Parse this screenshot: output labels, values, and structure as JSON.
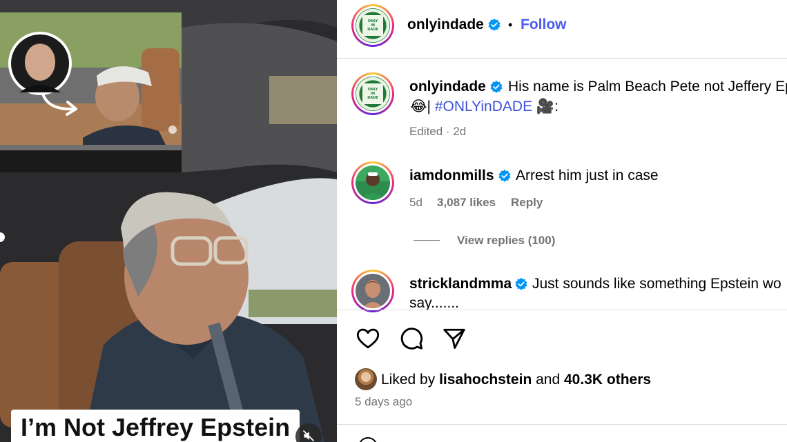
{
  "media": {
    "caption": "I’m Not Jeffrey Epstein",
    "mute_icon": "speaker-muted-icon"
  },
  "post": {
    "author": "onlyindade",
    "follow_label": "Follow",
    "separator": "•",
    "logo_text": [
      "ONLY",
      "IN",
      "DADE"
    ]
  },
  "caption_comment": {
    "username": "onlyindade",
    "text_line1": "His name is Palm Beach Pete not Jeffery Ep",
    "emoji_prefix": "😂",
    "pipe": "|",
    "hashtag": "#ONLYinDADE",
    "emoji_suffix": "🎥",
    "colon": ":",
    "edited": "Edited",
    "age": "2d"
  },
  "comments": [
    {
      "username": "iamdonmills",
      "text": "Arrest him just in case",
      "age": "5d",
      "likes": "3,087 likes",
      "reply_label": "Reply",
      "view_replies": "View replies (100)"
    },
    {
      "username": "stricklandmma",
      "text_line1": "Just sounds like something Epstein wo",
      "text_line2": "say......."
    }
  ],
  "actions": {
    "like_icon": "heart-icon",
    "comment_icon": "comment-icon",
    "share_icon": "send-icon"
  },
  "likes": {
    "prefix": "Liked by",
    "user": "lisahochstein",
    "conj": "and",
    "others": "40.3K others",
    "time": "5 days ago"
  },
  "colors": {
    "accent_blue": "#4a5df0",
    "hashtag_blue": "#3f51d8",
    "muted_gray": "#737373",
    "verified_blue": "#0095f6"
  }
}
